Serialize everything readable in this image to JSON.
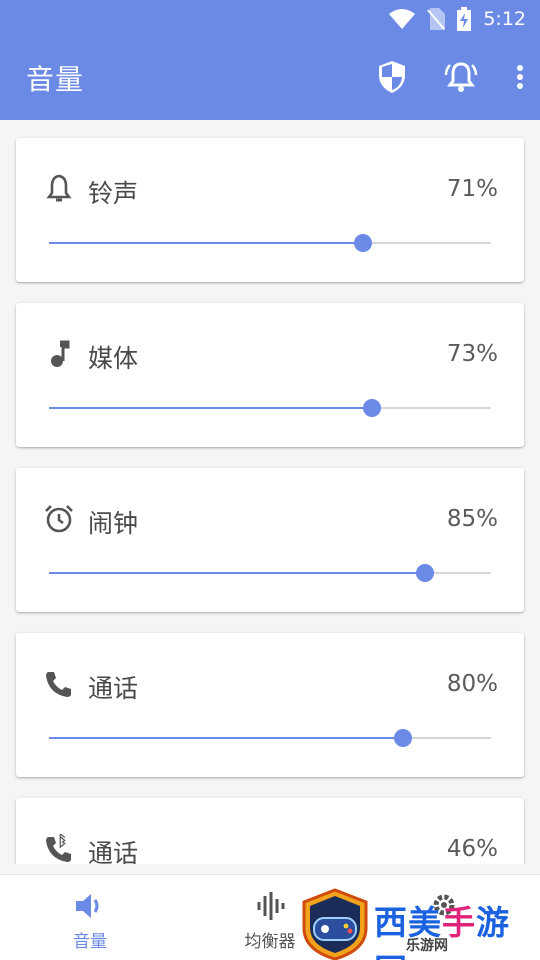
{
  "status_bar": {
    "time": "5:12"
  },
  "app_bar": {
    "title": "音量"
  },
  "channels": [
    {
      "name": "铃声",
      "percent_text": "71%",
      "level": 0.71,
      "icon": "bell-icon"
    },
    {
      "name": "媒体",
      "percent_text": "73%",
      "level": 0.73,
      "icon": "music-note-icon"
    },
    {
      "name": "闹钟",
      "percent_text": "85%",
      "level": 0.85,
      "icon": "alarm-clock-icon"
    },
    {
      "name": "通话",
      "percent_text": "80%",
      "level": 0.8,
      "icon": "phone-icon"
    },
    {
      "name": "通话",
      "percent_text": "46%",
      "level": 0.46,
      "icon": "bluetooth-phone-icon"
    }
  ],
  "bottom_nav": {
    "volume": "音量",
    "equalizer": "均衡器"
  },
  "watermark": {
    "text": "西美手游网",
    "sub": "乐游网"
  },
  "colors": {
    "accent": "#6a8ae6",
    "rail": "#d6d6d6",
    "watermark_blue": "#1a62e0",
    "watermark_pink": "#e0237a"
  }
}
